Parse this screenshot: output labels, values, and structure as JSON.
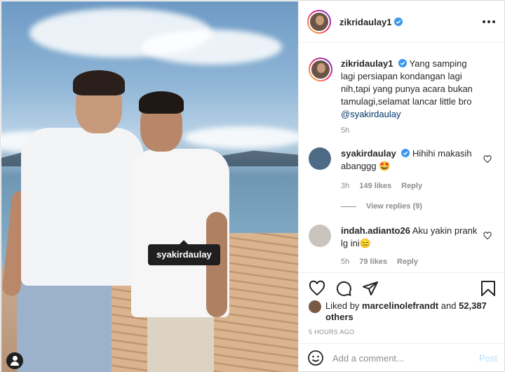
{
  "post": {
    "username": "zikridaulay1",
    "caption_user": "zikridaulay1",
    "caption": "Yang samping lagi persiapan kondangan lagi nih,tapi yang punya acara bukan tamulagi,selamat lancar little bro",
    "caption_mention": "@syakirdaulay",
    "caption_time": "5h",
    "photo_tag": "syakirdaulay"
  },
  "comments": [
    {
      "username": "syakirdaulay",
      "text": "Hihihi makasih abanggg 🤩",
      "time": "3h",
      "likes": "149 likes",
      "reply": "Reply"
    },
    {
      "username": "indah.adianto26",
      "text": "Aku yakin prank lg ini😑",
      "time": "5h",
      "likes": "79 likes",
      "reply": "Reply"
    }
  ],
  "view_replies": "View replies (9)",
  "liked_by": {
    "prefix": "Liked by",
    "user": "marcelinolefrandt",
    "and": "and",
    "others": "52,387 others"
  },
  "timestamp": "5 HOURS AGO",
  "add_comment": {
    "placeholder": "Add a comment...",
    "post_label": "Post"
  },
  "icons": {
    "verified": "verified-badge-icon",
    "more": "more-options-icon",
    "like": "heart-icon",
    "comment": "comment-bubble-icon",
    "share": "paper-plane-icon",
    "save": "bookmark-icon",
    "emoji": "smiley-icon",
    "tags": "user-tag-icon"
  },
  "colors": {
    "link": "#00376b",
    "verified": "#3897f0",
    "muted": "#8e8e8e",
    "post_disabled": "#b2dffc"
  }
}
